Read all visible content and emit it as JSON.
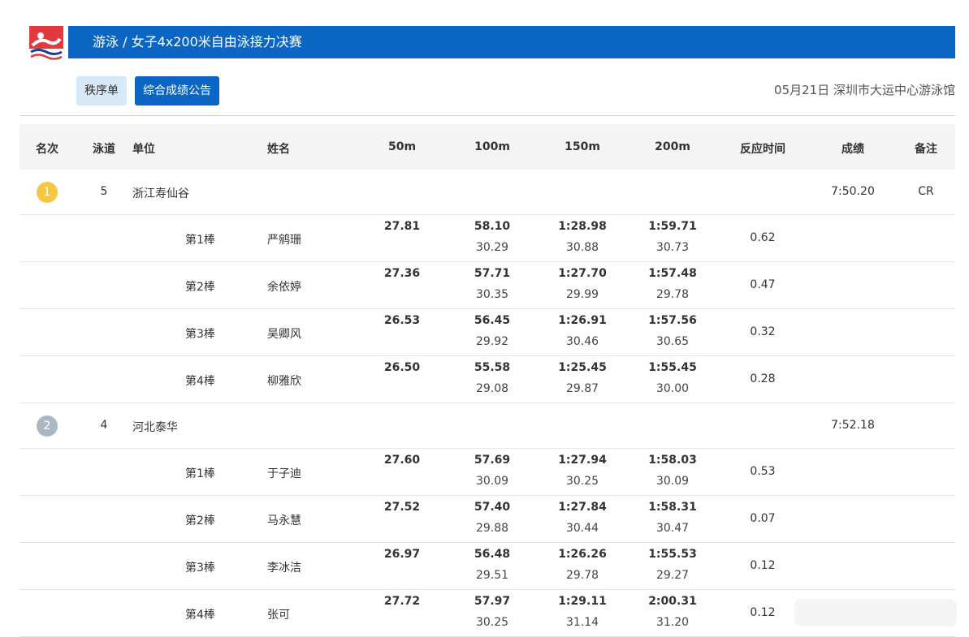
{
  "header": {
    "title": "游泳 / 女子4x200米自由泳接力决赛",
    "date_venue": "05月21日 深圳市大运中心游泳馆"
  },
  "tabs": {
    "order": "秩序单",
    "results": "综合成绩公告"
  },
  "columns": [
    "名次",
    "泳道",
    "单位",
    "姓名",
    "50m",
    "100m",
    "150m",
    "200m",
    "反应时间",
    "成绩",
    "备注"
  ],
  "teams": [
    {
      "rank": "1",
      "lane": "5",
      "unit": "浙江寿仙谷",
      "result": "7:50.20",
      "note": "CR",
      "badge_color": "#f5c842",
      "legs": [
        {
          "leg": "第1棒",
          "name": "严鹓珊",
          "cum": [
            "27.81",
            "58.10",
            "1:28.98",
            "1:59.71"
          ],
          "split": [
            "",
            "30.29",
            "30.88",
            "30.73"
          ],
          "rt": "0.62"
        },
        {
          "leg": "第2棒",
          "name": "余依婷",
          "cum": [
            "27.36",
            "57.71",
            "1:27.70",
            "1:57.48"
          ],
          "split": [
            "",
            "30.35",
            "29.99",
            "29.78"
          ],
          "rt": "0.47"
        },
        {
          "leg": "第3棒",
          "name": "吴卿风",
          "cum": [
            "26.53",
            "56.45",
            "1:26.91",
            "1:57.56"
          ],
          "split": [
            "",
            "29.92",
            "30.46",
            "30.65"
          ],
          "rt": "0.32"
        },
        {
          "leg": "第4棒",
          "name": "柳雅欣",
          "cum": [
            "26.50",
            "55.58",
            "1:25.45",
            "1:55.45"
          ],
          "split": [
            "",
            "29.08",
            "29.87",
            "30.00"
          ],
          "rt": "0.28"
        }
      ]
    },
    {
      "rank": "2",
      "lane": "4",
      "unit": "河北泰华",
      "result": "7:52.18",
      "note": "",
      "badge_color": "#a9b8c4",
      "legs": [
        {
          "leg": "第1棒",
          "name": "于子迪",
          "cum": [
            "27.60",
            "57.69",
            "1:27.94",
            "1:58.03"
          ],
          "split": [
            "",
            "30.09",
            "30.25",
            "30.09"
          ],
          "rt": "0.53"
        },
        {
          "leg": "第2棒",
          "name": "马永慧",
          "cum": [
            "27.52",
            "57.40",
            "1:27.84",
            "1:58.31"
          ],
          "split": [
            "",
            "29.88",
            "30.44",
            "30.47"
          ],
          "rt": "0.07"
        },
        {
          "leg": "第3棒",
          "name": "李冰洁",
          "cum": [
            "26.97",
            "56.48",
            "1:26.26",
            "1:55.53"
          ],
          "split": [
            "",
            "29.51",
            "29.78",
            "29.27"
          ],
          "rt": "0.12"
        },
        {
          "leg": "第4棒",
          "name": "张可",
          "cum": [
            "27.72",
            "57.97",
            "1:29.11",
            "2:00.31"
          ],
          "split": [
            "",
            "30.25",
            "31.14",
            "31.20"
          ],
          "rt": "0.12"
        }
      ]
    }
  ]
}
